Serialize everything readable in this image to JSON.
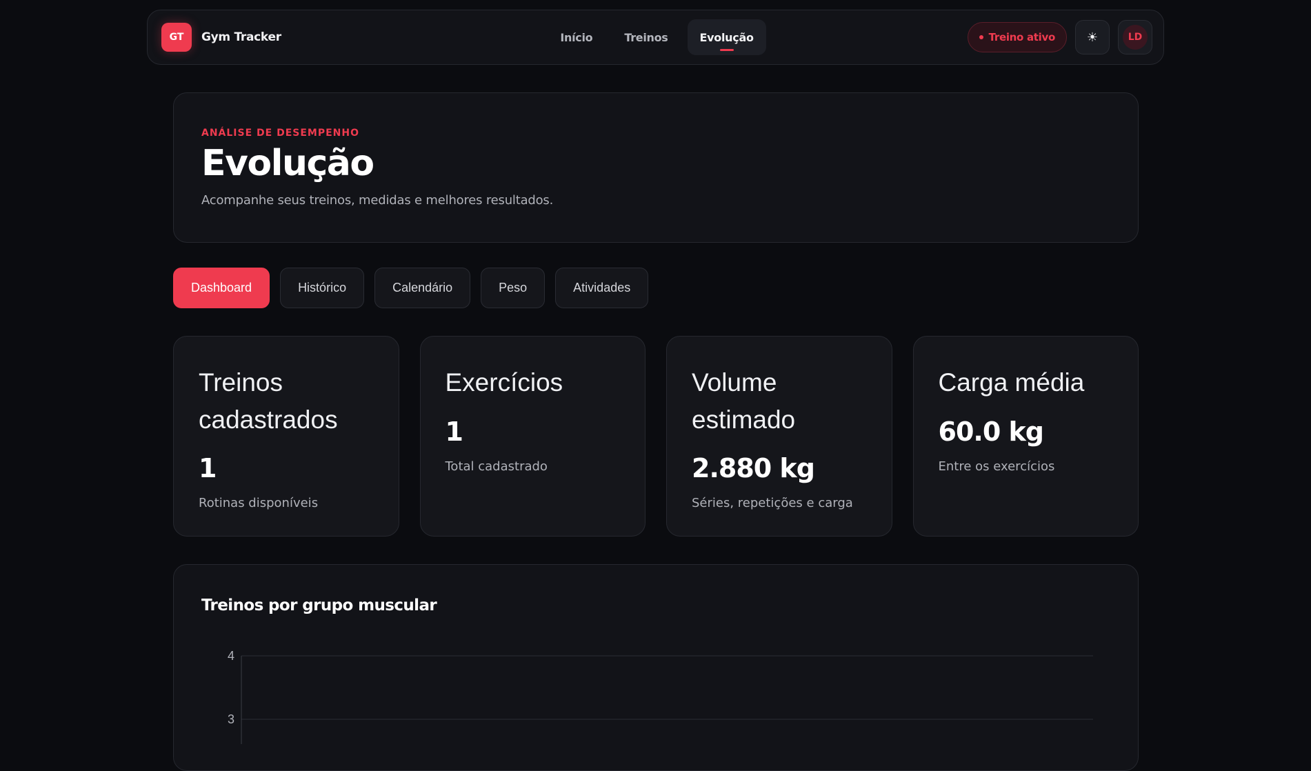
{
  "brand": {
    "logo": "GT",
    "name": "Gym Tracker"
  },
  "nav": {
    "links": [
      {
        "label": "Início"
      },
      {
        "label": "Treinos"
      },
      {
        "label": "Evolução"
      }
    ],
    "active_workout": "Treino ativo",
    "theme_icon": "sun-icon",
    "avatar": "LD"
  },
  "hero": {
    "eyebrow": "ANÁLISE DE DESEMPENHO",
    "title": "Evolução",
    "subtitle": "Acompanhe seus treinos, medidas e melhores resultados."
  },
  "tabs": [
    {
      "label": "Dashboard"
    },
    {
      "label": "Histórico"
    },
    {
      "label": "Calendário"
    },
    {
      "label": "Peso"
    },
    {
      "label": "Atividades"
    }
  ],
  "stats": [
    {
      "label": "Treinos cadastrados",
      "value": "1",
      "desc": "Rotinas disponíveis"
    },
    {
      "label": "Exercícios",
      "value": "1",
      "desc": "Total cadastrado"
    },
    {
      "label": "Volume estimado",
      "value": "2.880 kg",
      "desc": "Séries, repetições e carga"
    },
    {
      "label": "Carga média",
      "value": "60.0 kg",
      "desc": "Entre os exercícios"
    }
  ],
  "chart_data": {
    "type": "bar",
    "title": "Treinos por grupo muscular",
    "y_ticks": [
      "4",
      "3"
    ],
    "ylim": [
      0,
      4
    ],
    "grid": true,
    "categories": [],
    "values": []
  },
  "colors": {
    "accent": "#ef3b4f",
    "background": "#0b0c10",
    "card": "#15161b"
  }
}
